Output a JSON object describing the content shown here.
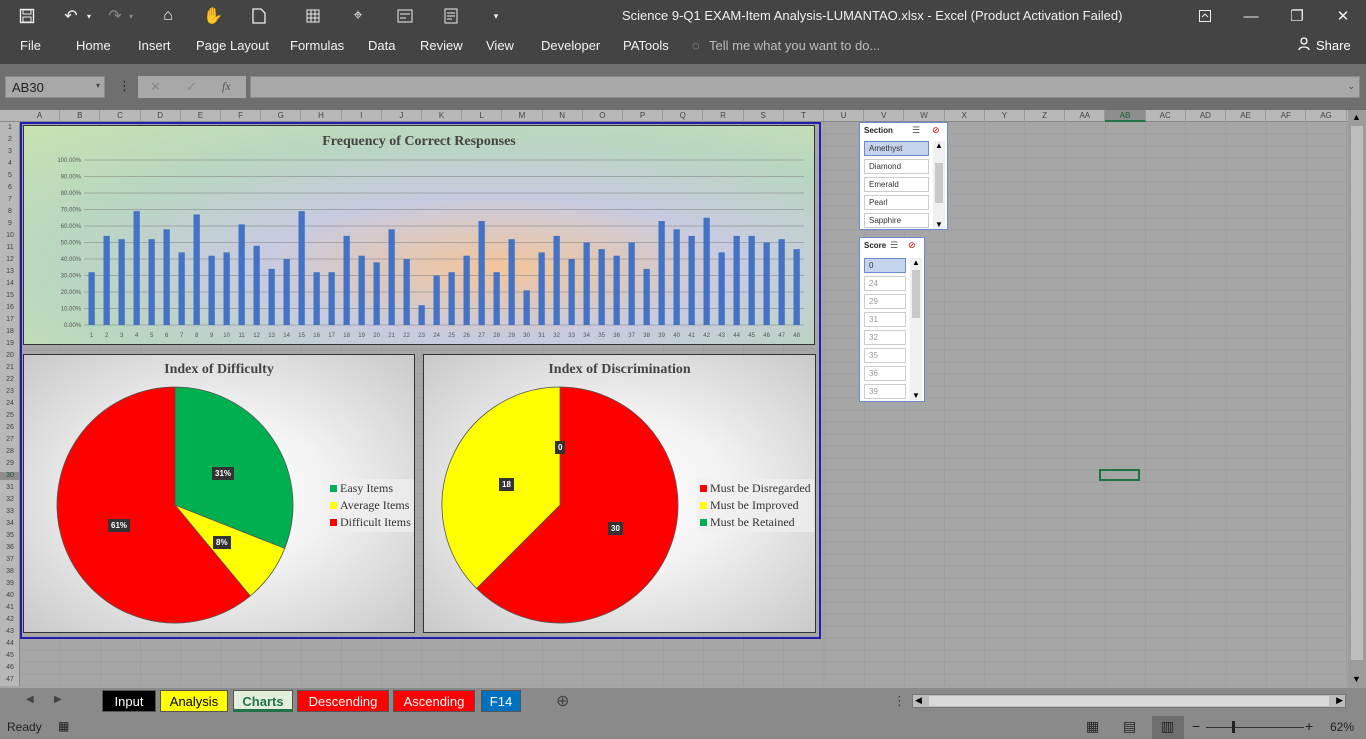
{
  "window": {
    "title": "Science 9-Q1 EXAM-Item Analysis-LUMANTAO.xlsx - Excel (Product Activation Failed)"
  },
  "ribbon": {
    "file": "File",
    "tabs": [
      "Home",
      "Insert",
      "Page Layout",
      "Formulas",
      "Data",
      "Review",
      "View",
      "Developer",
      "PATools"
    ],
    "tell_me": "Tell me what you want to do...",
    "share": "Share"
  },
  "formula_bar": {
    "name_box": "AB30",
    "fx": "fx",
    "value": ""
  },
  "columns": [
    "A",
    "B",
    "C",
    "D",
    "E",
    "F",
    "G",
    "H",
    "I",
    "J",
    "K",
    "L",
    "M",
    "N",
    "O",
    "P",
    "Q",
    "R",
    "S",
    "T",
    "U",
    "V",
    "W",
    "X",
    "Y",
    "Z",
    "AA",
    "AB",
    "AC",
    "AD",
    "AE",
    "AF",
    "AG"
  ],
  "rows": [
    "1",
    "2",
    "3",
    "4",
    "5",
    "6",
    "7",
    "8",
    "9",
    "10",
    "11",
    "12",
    "13",
    "14",
    "15",
    "16",
    "17",
    "18",
    "19",
    "20",
    "21",
    "22",
    "23",
    "24",
    "25",
    "26",
    "27",
    "28",
    "29",
    "30",
    "31",
    "32",
    "33",
    "34",
    "35",
    "36",
    "37",
    "38",
    "39",
    "40",
    "41",
    "42",
    "43",
    "44",
    "45",
    "46",
    "47"
  ],
  "charts": {
    "frequency": {
      "title": "Frequency of Correct Responses",
      "y_ticks": [
        "100.00%",
        "90.00%",
        "80.00%",
        "70.00%",
        "60.00%",
        "50.00%",
        "40.00%",
        "30.00%",
        "20.00%",
        "10.00%",
        "0.00%"
      ],
      "ylim": [
        0,
        100
      ],
      "bar_color": "#4472c4"
    },
    "difficulty": {
      "title": "Index of Difficulty",
      "legend": [
        "Easy Items",
        "Average Items",
        "Difficult Items"
      ],
      "colors": [
        "#00b050",
        "#ffff00",
        "#ff0000"
      ]
    },
    "discrimination": {
      "title": "Index of Discrimination",
      "legend": [
        "Must be Disregarded",
        "Must be Improved",
        "Must be Retained"
      ],
      "colors": [
        "#ff0000",
        "#ffff00",
        "#00b050"
      ]
    }
  },
  "chart_data": [
    {
      "type": "bar",
      "title": "Frequency of Correct Responses",
      "categories": [
        "1",
        "2",
        "3",
        "4",
        "5",
        "6",
        "7",
        "8",
        "9",
        "10",
        "11",
        "12",
        "13",
        "14",
        "15",
        "16",
        "17",
        "18",
        "19",
        "20",
        "21",
        "22",
        "23",
        "24",
        "25",
        "26",
        "27",
        "28",
        "29",
        "30",
        "31",
        "32",
        "33",
        "34",
        "35",
        "36",
        "37",
        "38",
        "39",
        "40",
        "41",
        "42",
        "43",
        "44",
        "45",
        "46",
        "47",
        "48"
      ],
      "values": [
        32,
        54,
        52,
        69,
        52,
        58,
        44,
        67,
        42,
        44,
        61,
        48,
        34,
        40,
        69,
        32,
        32,
        54,
        42,
        38,
        58,
        40,
        12,
        30,
        32,
        42,
        63,
        32,
        52,
        21,
        44,
        54,
        40,
        50,
        46,
        42,
        50,
        34,
        63,
        58,
        54,
        65,
        44,
        54,
        54,
        50,
        52,
        46
      ],
      "ylim": [
        0,
        100
      ],
      "ylabel": "",
      "xlabel": ""
    },
    {
      "type": "pie",
      "title": "Index of Difficulty",
      "labels": [
        "Easy Items",
        "Average Items",
        "Difficult Items"
      ],
      "values": [
        31,
        8,
        61
      ],
      "data_labels": [
        "31%",
        "8%",
        "61%"
      ]
    },
    {
      "type": "pie",
      "title": "Index of Discrimination",
      "labels": [
        "Must be Disregarded",
        "Must be Improved",
        "Must be Retained"
      ],
      "values": [
        30,
        18,
        0
      ],
      "data_labels": [
        "30",
        "18",
        "0"
      ]
    }
  ],
  "slicers": {
    "section": {
      "title": "Section",
      "items": [
        "Amethyst",
        "Diamond",
        "Emerald",
        "Pearl",
        "Sapphire"
      ]
    },
    "score": {
      "title": "Score",
      "items": [
        "0",
        "24",
        "29",
        "31",
        "32",
        "35",
        "36",
        "39"
      ]
    }
  },
  "sheet_tabs": [
    {
      "label": "Input",
      "bg": "#000000",
      "fg": "#ffffff"
    },
    {
      "label": "Analysis",
      "bg": "#ffff00",
      "fg": "#000000"
    },
    {
      "label": "Charts",
      "bg": "#e2efda",
      "fg": "#217346"
    },
    {
      "label": "Descending",
      "bg": "#ff0000",
      "fg": "#ffffff"
    },
    {
      "label": "Ascending",
      "bg": "#ff0000",
      "fg": "#ffffff"
    },
    {
      "label": "F14",
      "bg": "#0070c0",
      "fg": "#ffffff"
    }
  ],
  "status": {
    "ready": "Ready",
    "zoom": "62%"
  }
}
